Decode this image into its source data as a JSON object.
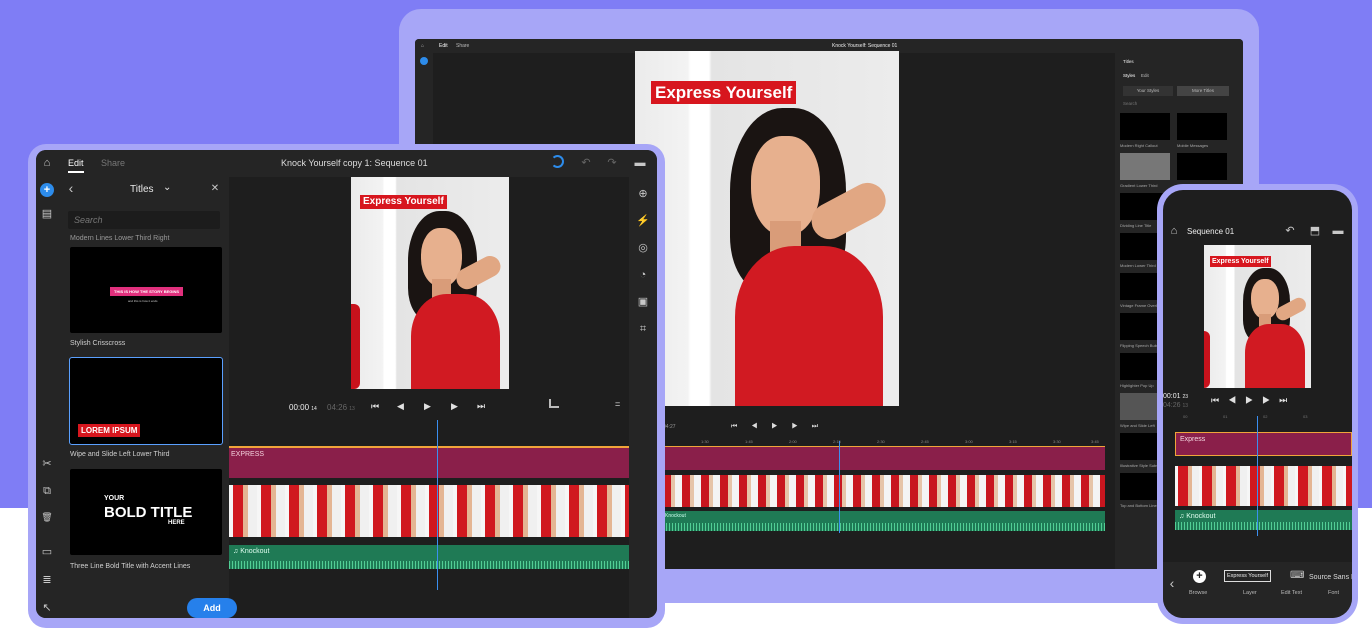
{
  "laptop": {
    "tabs": [
      "Edit",
      "Share"
    ],
    "title": "Knock Yourself: Sequence 01",
    "video_title": "Express Yourself",
    "panel_header": "Titles",
    "panel_tabs": [
      "Styles",
      "Edit"
    ],
    "panel_buttons": [
      "Your Styles",
      "More Titles"
    ],
    "search_placeholder": "Search",
    "templates": [
      {
        "label": "Modern Right Callout"
      },
      {
        "label": "Mobile Messages"
      },
      {
        "label": "Gradient Lower Third"
      },
      {
        "label": "Dividing Line Title"
      },
      {
        "label": "Modern Lower Third"
      },
      {
        "label": "Vintage Frame Overlay"
      },
      {
        "label": "Flipping Speech Bubble"
      },
      {
        "label": "Highlighter Pop Up"
      },
      {
        "label": "Wipe and Slide Left"
      },
      {
        "label": "Illustrative Style Subscribe"
      },
      {
        "label": "Top and Bottom Lines"
      }
    ],
    "timecode": "04:27",
    "ruler": [
      "1:30",
      "1:45",
      "2:00",
      "2:15",
      "2:30",
      "2:45",
      "3:00",
      "3:15",
      "3:30",
      "3:45"
    ],
    "audio_label": "Knockout"
  },
  "tablet": {
    "tabs": [
      "Edit",
      "Share"
    ],
    "title": "Knock Yourself copy 1: Sequence 01",
    "panel_title": "Titles",
    "search_placeholder": "Search",
    "partial_label": "Modern Lines Lower Third Right",
    "templates": [
      {
        "label": "Stylish Crisscross",
        "text": "THIS IS HOW THE STORY BEGINS",
        "subtext": "and this is how it ends"
      },
      {
        "label": "Wipe and Slide Left Lower Third",
        "text": "LOREM IPSUM"
      },
      {
        "label": "Three Line Bold Title with Accent Lines",
        "line1": "YOUR",
        "line2": "BOLD TITLE",
        "line3": "HERE"
      }
    ],
    "add_button": "Add",
    "video_title": "Express Yourself",
    "timecode_current": "00:00",
    "timecode_current_frames": "14",
    "timecode_total": "04:26",
    "timecode_total_frames": "13",
    "title_track_label": "EXPRESS",
    "audio_label": "Knockout",
    "icons": {
      "home": "⌂",
      "add": "+",
      "media": "▤",
      "split": "✂",
      "duplicate": "⧉",
      "delete": "🗑",
      "layout": "▭",
      "list": "≣",
      "select": "↖",
      "back": "‹",
      "close": "✕",
      "chevron": "⌄",
      "undo": "↶",
      "redo": "↷",
      "chat": "▬",
      "right_titles": "⊕",
      "right_speed": "⚡",
      "right_color": "◎",
      "right_gauge": "◔",
      "right_crop": "▣",
      "right_transform": "⌗",
      "skip_start": "⏮",
      "step_back": "◀",
      "play": "▶",
      "step_fwd": "▶",
      "skip_end": "⏭"
    }
  },
  "phone": {
    "title": "Sequence 01",
    "video_title": "Express Yourself",
    "timecode": "00:01",
    "timecode_frames": "23",
    "timecode_total": "04:26",
    "timecode_total_frames": "13",
    "ruler": [
      "00",
      "01",
      "02",
      "03"
    ],
    "title_track_label": "Express",
    "audio_label": "Knockout",
    "tools": [
      {
        "label": "Browse",
        "icon": "+"
      },
      {
        "label": "Layer",
        "icon": "Express Yourself"
      },
      {
        "label": "Edit Text",
        "icon": "⌨"
      },
      {
        "label": "Font",
        "icon": "Source Sans Pro"
      }
    ],
    "icons": {
      "home": "⌂",
      "undo": "↶",
      "export": "⬒",
      "chat": "▬",
      "back": "‹"
    }
  }
}
